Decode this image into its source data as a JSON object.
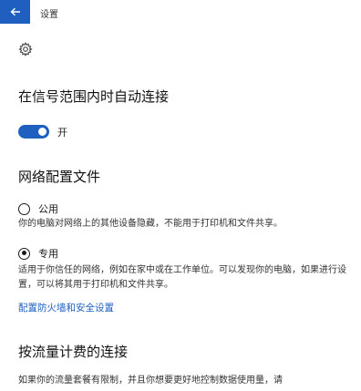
{
  "window": {
    "title": "设置",
    "back_icon": "arrow-left-icon",
    "accent": "#1e5fbf"
  },
  "page": {
    "icon": "gear-icon"
  },
  "auto_connect": {
    "heading": "在信号范围内时自动连接",
    "toggle_state_label": "开",
    "toggle_on": true
  },
  "network_profile": {
    "heading": "网络配置文件",
    "options": [
      {
        "label": "公用",
        "description": "你的电脑对网络上的其他设备隐藏，不能用于打印机和文件共享。",
        "selected": false
      },
      {
        "label": "专用",
        "description": "适用于你信任的网络，例如在家中或在工作单位。可以发现你的电脑，如果进行设置，可以将其用于打印机和文件共享。",
        "selected": true
      }
    ],
    "firewall_link": "配置防火墙和安全设置"
  },
  "metered": {
    "heading": "按流量计费的连接",
    "description": "如果你的流量套餐有限制，并且你想要更好地控制数据使用量，请"
  }
}
